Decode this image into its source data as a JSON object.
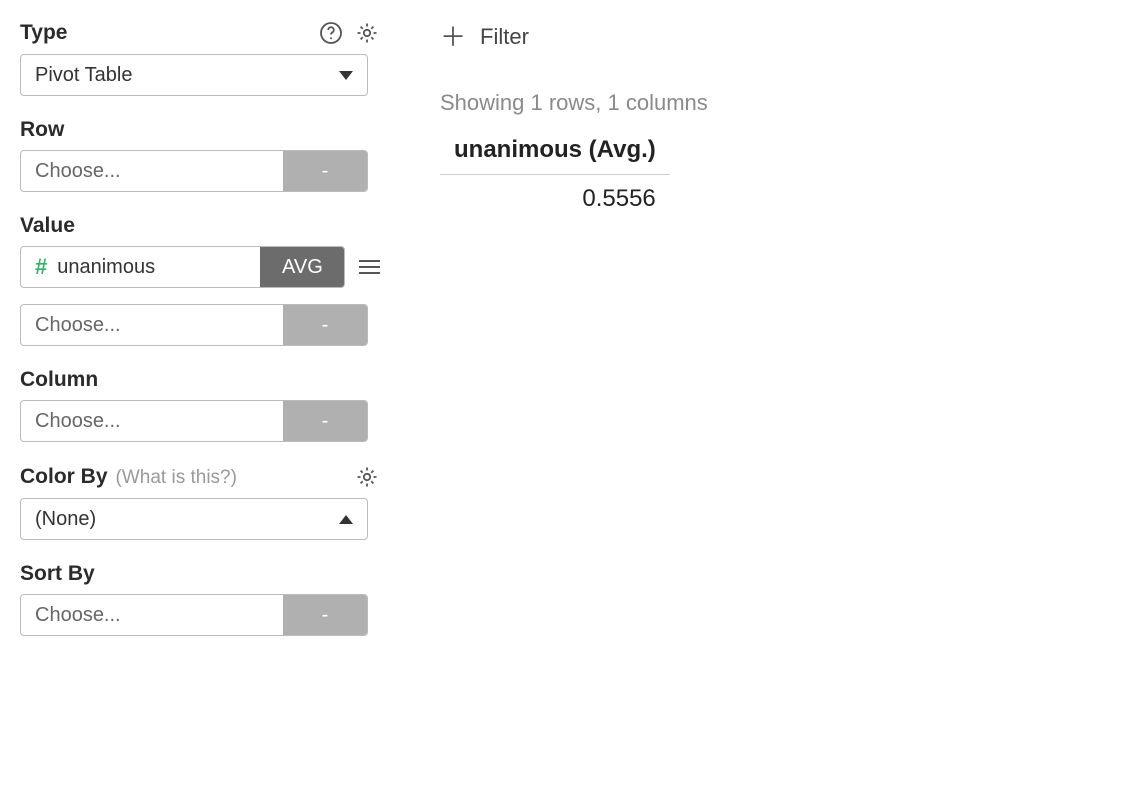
{
  "sidebar": {
    "type": {
      "label": "Type",
      "value": "Pivot Table"
    },
    "row": {
      "label": "Row",
      "placeholder": "Choose...",
      "agg": "-"
    },
    "value": {
      "label": "Value",
      "field": "unanimous",
      "agg": "AVG",
      "extra_placeholder": "Choose...",
      "extra_agg": "-"
    },
    "column": {
      "label": "Column",
      "placeholder": "Choose...",
      "agg": "-"
    },
    "color_by": {
      "label": "Color By",
      "hint": "(What is this?)",
      "value": "(None)"
    },
    "sort_by": {
      "label": "Sort By",
      "placeholder": "Choose...",
      "agg": "-"
    }
  },
  "main": {
    "filter_label": "Filter",
    "result_meta": "Showing 1 rows, 1 columns",
    "result_header": "unanimous (Avg.)",
    "result_value": "0.5556"
  }
}
